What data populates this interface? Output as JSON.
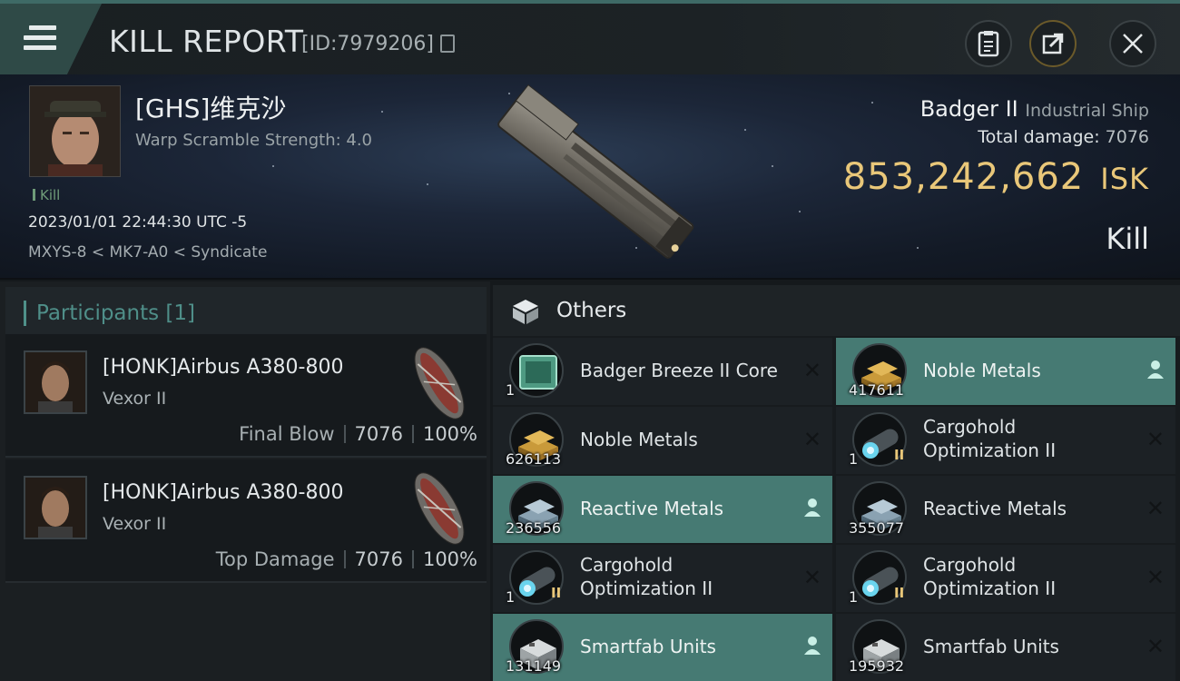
{
  "header": {
    "title": "KILL REPORT",
    "report_id": "[ID:7979206]",
    "icons": {
      "menu": "hamburger-menu-icon",
      "copy": "copy-icon",
      "clipboard": "clipboard-icon",
      "share": "share-icon",
      "close": "close-icon"
    }
  },
  "victim": {
    "name": "[GHS]维克沙",
    "warp_scramble": "Warp Scramble Strength: 4.0",
    "tag": "Kill",
    "datetime": "2023/01/01 22:44:30 UTC -5",
    "location": "MXYS-8 < MK7-A0 < Syndicate",
    "ship": "Badger II",
    "ship_class": "Industrial Ship",
    "total_damage_label": "Total damage:",
    "total_damage": "7076",
    "isk_value": "853,242,662",
    "isk_unit": "ISK",
    "status": "Kill"
  },
  "participants": {
    "header": "Participants [1]",
    "rows": [
      {
        "name": "[HONK]Airbus A380-800",
        "ship": "Vexor II",
        "role": "Final Blow",
        "damage": "7076",
        "percent": "100%"
      },
      {
        "name": "[HONK]Airbus A380-800",
        "ship": "Vexor II",
        "role": "Top Damage",
        "damage": "7076",
        "percent": "100%"
      }
    ]
  },
  "others": {
    "header": "Others",
    "items": [
      {
        "name": "Badger Breeze II Core",
        "qty": "1",
        "highlighted": false,
        "icon": "core-icon"
      },
      {
        "name": "Noble Metals",
        "qty": "417611",
        "highlighted": true,
        "icon": "noble-metals-icon"
      },
      {
        "name": "Noble Metals",
        "qty": "626113",
        "highlighted": false,
        "icon": "noble-metals-icon"
      },
      {
        "name": "Cargohold Optimization II",
        "qty": "1",
        "highlighted": false,
        "icon": "cargohold-optimization-icon"
      },
      {
        "name": "Reactive Metals",
        "qty": "236556",
        "highlighted": true,
        "icon": "reactive-metals-icon"
      },
      {
        "name": "Reactive Metals",
        "qty": "355077",
        "highlighted": false,
        "icon": "reactive-metals-icon"
      },
      {
        "name": "Cargohold Optimization II",
        "qty": "1",
        "highlighted": false,
        "icon": "cargohold-optimization-icon"
      },
      {
        "name": "Cargohold Optimization II",
        "qty": "1",
        "highlighted": false,
        "icon": "cargohold-optimization-icon"
      },
      {
        "name": "Smartfab Units",
        "qty": "131149",
        "highlighted": true,
        "icon": "smartfab-units-icon"
      },
      {
        "name": "Smartfab Units",
        "qty": "195932",
        "highlighted": false,
        "icon": "smartfab-units-icon"
      }
    ]
  },
  "colors": {
    "accent_teal": "#467a73",
    "isk_gold": "#e9c779",
    "participants_header": "#4f8f89"
  }
}
